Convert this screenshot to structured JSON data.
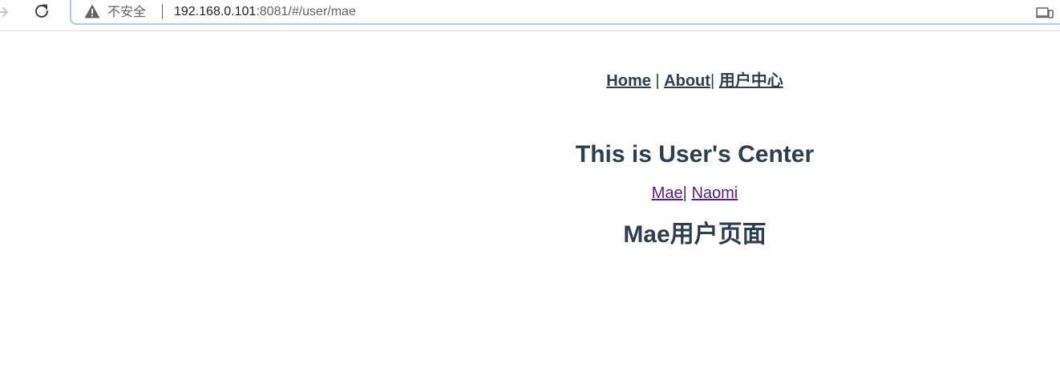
{
  "browser": {
    "security_label": "不安全",
    "url_host": "192.168.0.101",
    "url_rest": ":8081/#/user/mae"
  },
  "nav": {
    "home": "Home",
    "sep1": " | ",
    "about": "About",
    "sep2": "| ",
    "user_center": "用户中心"
  },
  "page": {
    "title": "This is User's Center",
    "users": {
      "mae": "Mae",
      "sep": "| ",
      "naomi": "Naomi"
    },
    "user_page_title": "Mae用户页面"
  },
  "colors": {
    "text": "#2c3e50",
    "visited_link": "#551a8b",
    "omnibox_focus": "#a8c7fa"
  }
}
